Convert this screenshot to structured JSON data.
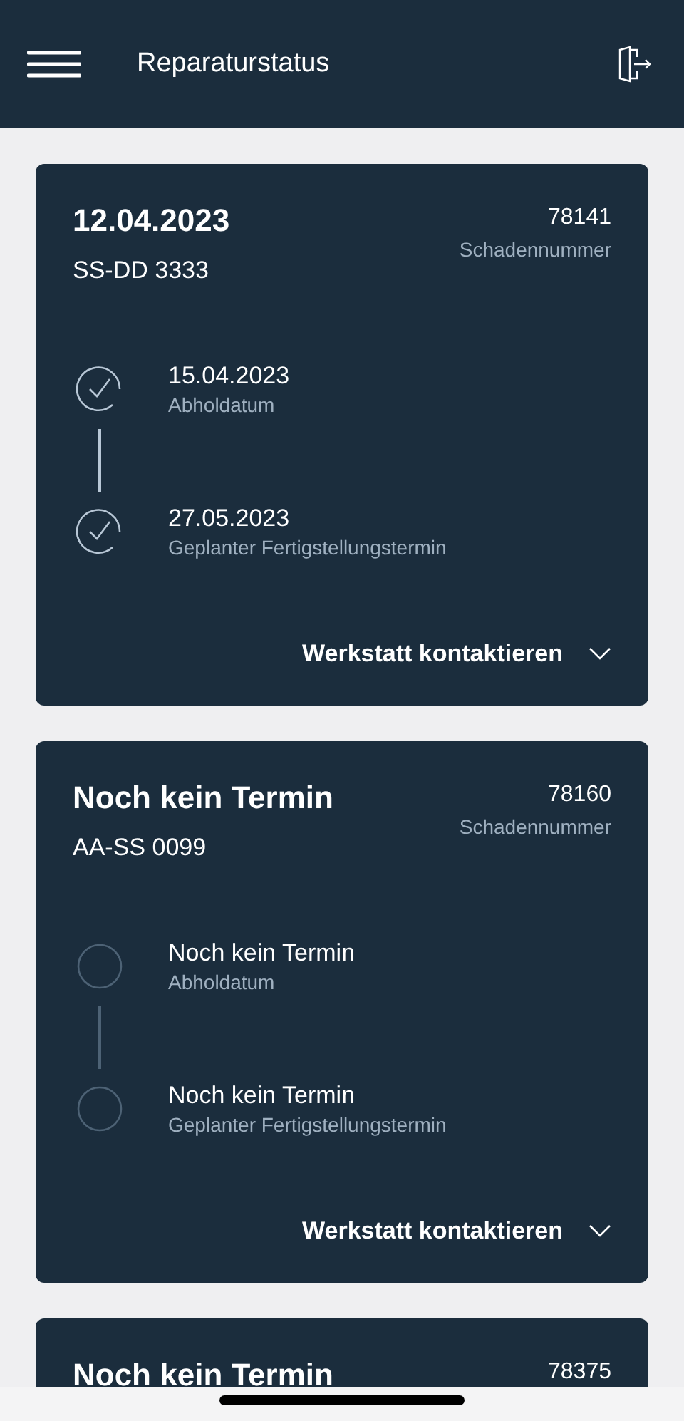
{
  "header": {
    "title": "Reparaturstatus"
  },
  "cards": [
    {
      "title": "12.04.2023",
      "plate": "SS-DD 3333",
      "number": "78141",
      "number_label": "Schadennummer",
      "steps": [
        {
          "date": "15.04.2023",
          "label": "Abholdatum",
          "done": true
        },
        {
          "date": "27.05.2023",
          "label": "Geplanter Fertigstellungstermin",
          "done": true
        }
      ],
      "action": "Werkstatt kontaktieren"
    },
    {
      "title": "Noch kein Termin",
      "plate": "AA-SS 0099",
      "number": "78160",
      "number_label": "Schadennummer",
      "steps": [
        {
          "date": "Noch kein Termin",
          "label": "Abholdatum",
          "done": false
        },
        {
          "date": "Noch kein Termin",
          "label": "Geplanter Fertigstellungstermin",
          "done": false
        }
      ],
      "action": "Werkstatt kontaktieren"
    },
    {
      "title": "Noch kein Termin",
      "number": "78375"
    }
  ]
}
